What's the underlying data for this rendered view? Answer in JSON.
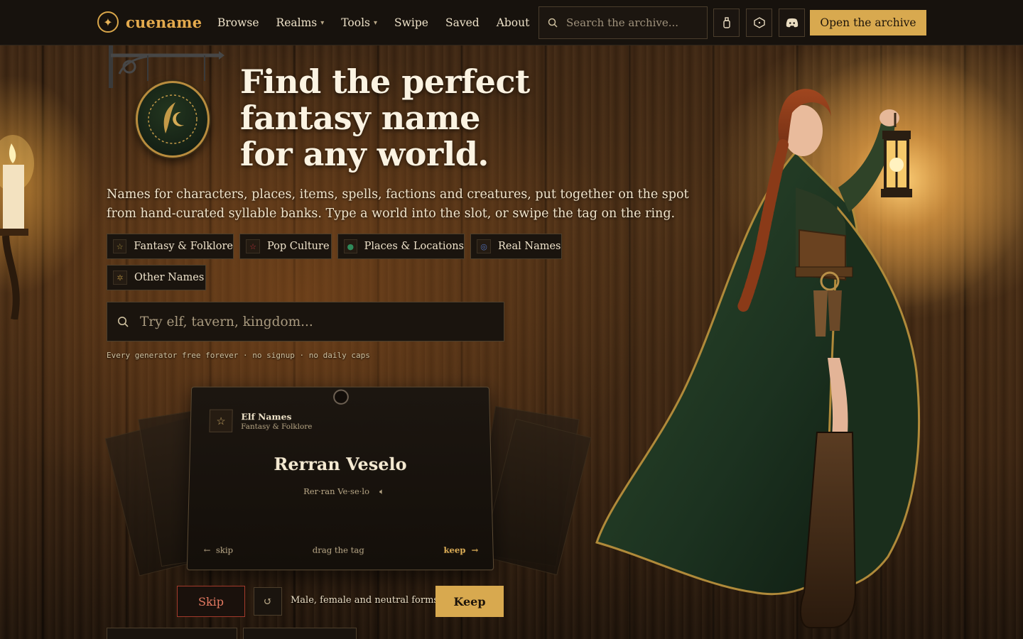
{
  "brand": {
    "name": "cuename"
  },
  "nav": {
    "items": [
      {
        "label": "Browse",
        "has_menu": false
      },
      {
        "label": "Realms",
        "has_menu": true
      },
      {
        "label": "Tools",
        "has_menu": true
      },
      {
        "label": "Swipe",
        "has_menu": false
      },
      {
        "label": "Saved",
        "has_menu": false
      },
      {
        "label": "About",
        "has_menu": false
      }
    ],
    "search_placeholder": "Search the archive...",
    "cta_label": "Open the archive",
    "icons": [
      "bottle-icon",
      "dice-icon",
      "discord-icon"
    ]
  },
  "hero": {
    "title_line1": "Find the perfect",
    "title_line2": "fantasy name",
    "title_line3": "for any world.",
    "subtitle": "Names for characters, places, items, spells, factions and creatures, put together on the spot from hand-curated syllable banks. Type a world into the slot, or swipe the tag on the ring."
  },
  "categories": [
    {
      "label": "Fantasy & Folklore",
      "icon": "star-icon",
      "color": "#a8923e"
    },
    {
      "label": "Pop Culture",
      "icon": "star-icon",
      "color": "#b0303a"
    },
    {
      "label": "Places & Locations",
      "icon": "pin-icon",
      "color": "#2f8a5a"
    },
    {
      "label": "Real Names",
      "icon": "globe-icon",
      "color": "#4f6fb8"
    },
    {
      "label": "Other Names",
      "icon": "gear-icon",
      "color": "#8a6d32"
    }
  ],
  "search": {
    "placeholder": "Try elf, tavern, kingdom...",
    "fineprint": "Every generator free forever · no signup · no daily caps"
  },
  "card": {
    "generator": "Elf Names",
    "category": "Fantasy & Folklore",
    "name": "Rerran Veselo",
    "pronunciation": "Rer·ran Ve·se·lo",
    "skip_hint": "skip",
    "drag_hint": "drag the tag",
    "keep_hint": "keep"
  },
  "controls": {
    "skip_label": "Skip",
    "keep_label": "Keep",
    "forms_note": "Male, female and neutral forms"
  },
  "colors": {
    "accent": "#d8a94f",
    "skip": "#a33a2b",
    "topbar": "#17120d"
  }
}
